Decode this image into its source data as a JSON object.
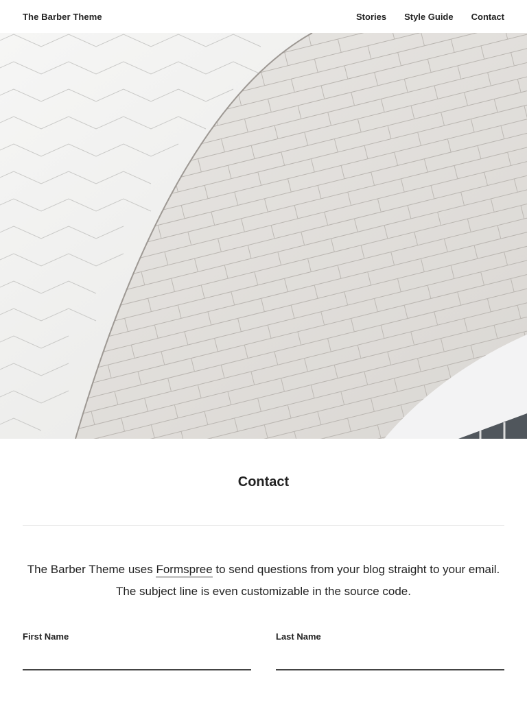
{
  "header": {
    "site_title": "The Barber Theme",
    "nav": [
      {
        "label": "Stories"
      },
      {
        "label": "Style Guide"
      },
      {
        "label": "Contact"
      }
    ]
  },
  "hero": {
    "image": "white-tiled-curved-architecture"
  },
  "page": {
    "title": "Contact",
    "intro_before": "The Barber Theme uses ",
    "intro_link": "Formspree",
    "intro_after": " to send questions from your blog straight to your email. The subject line is even customizable in the source code."
  },
  "form": {
    "first_name_label": "First Name",
    "first_name_value": "",
    "last_name_label": "Last Name",
    "last_name_value": ""
  },
  "colors": {
    "text": "#222222",
    "link_underline": "#c8c8c8",
    "divider": "#ececec",
    "input_border": "#444444"
  }
}
